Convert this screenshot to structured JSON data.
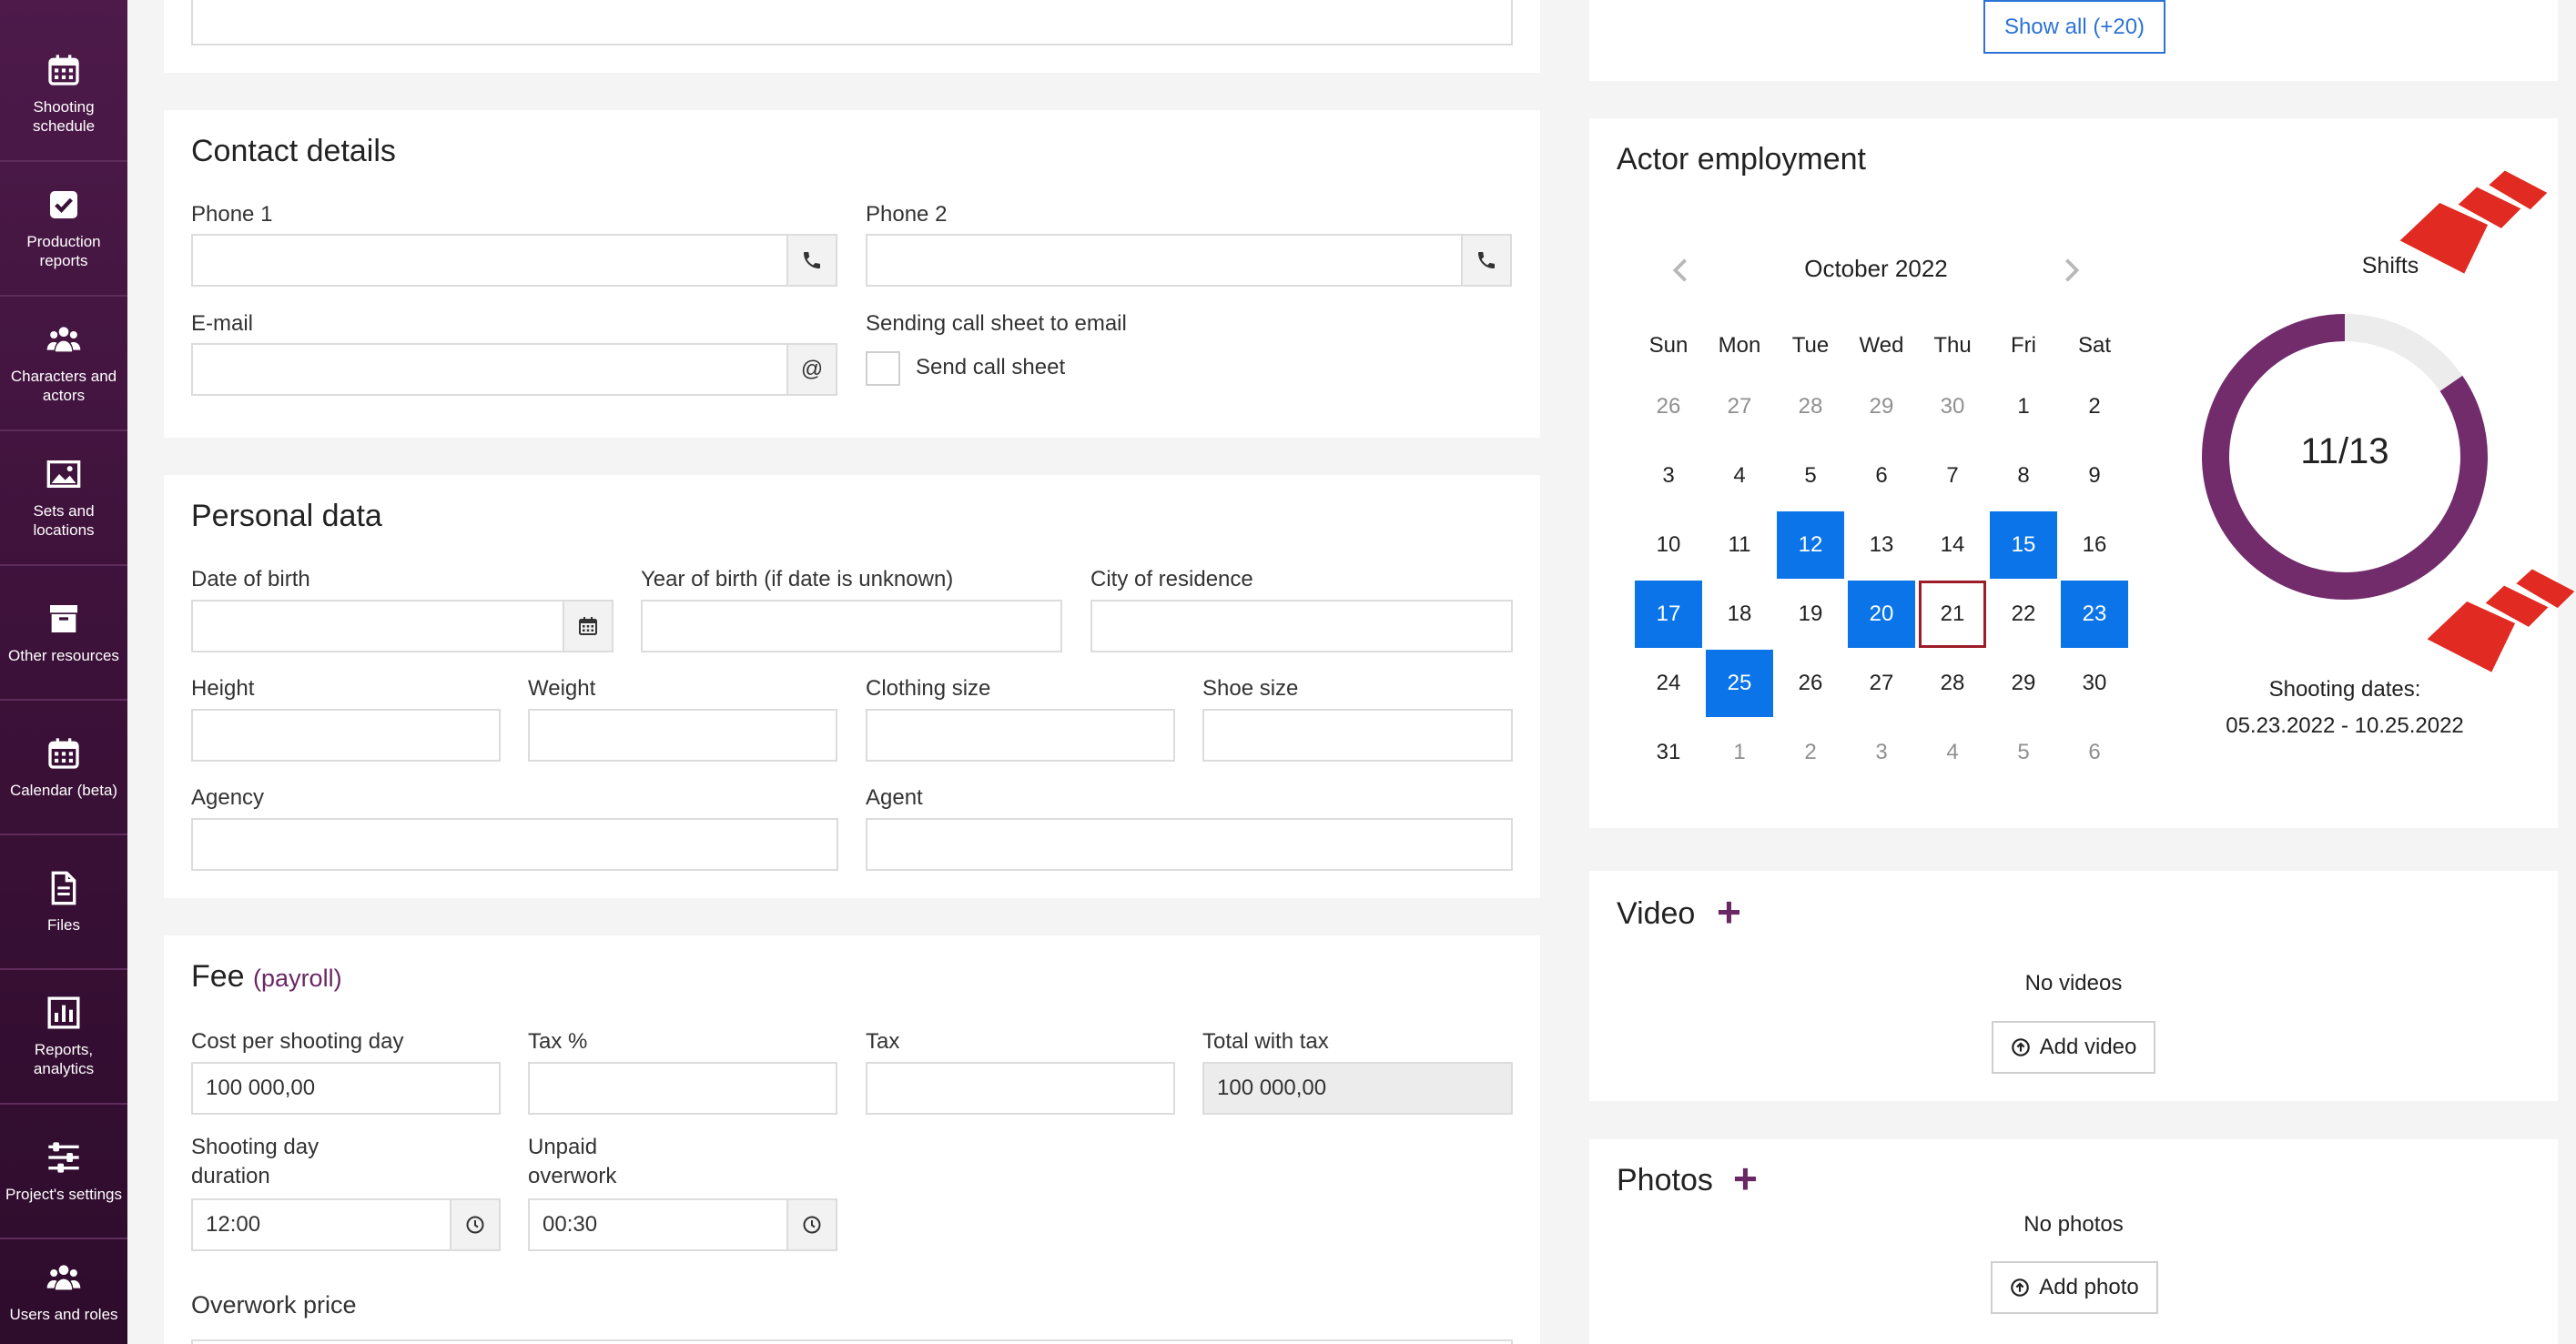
{
  "sidebar": {
    "items": [
      {
        "label": "Shooting schedule",
        "icon": "calendar-grid-icon"
      },
      {
        "label": "Production reports",
        "icon": "checkbox-icon"
      },
      {
        "label": "Characters and actors",
        "icon": "people-icon"
      },
      {
        "label": "Sets and locations",
        "icon": "picture-icon"
      },
      {
        "label": "Other resources",
        "icon": "archive-box-icon"
      },
      {
        "label": "Calendar (beta)",
        "icon": "calendar-grid-icon"
      },
      {
        "label": "Files",
        "icon": "file-icon"
      },
      {
        "label": "Reports, analytics",
        "icon": "bar-chart-icon"
      },
      {
        "label": "Project's settings",
        "icon": "sliders-icon"
      },
      {
        "label": "Users and roles",
        "icon": "people-icon"
      }
    ]
  },
  "contact": {
    "title": "Contact details",
    "phone1_label": "Phone 1",
    "phone2_label": "Phone 2",
    "email_label": "E-mail",
    "email_addon": "@",
    "sending_label": "Sending call sheet to email",
    "send_checkbox_label": "Send call sheet"
  },
  "personal": {
    "title": "Personal data",
    "dob_label": "Date of birth",
    "yob_label": "Year of birth (if date is unknown)",
    "city_label": "City of residence",
    "height_label": "Height",
    "weight_label": "Weight",
    "clothing_label": "Clothing size",
    "shoe_label": "Shoe size",
    "agency_label": "Agency",
    "agent_label": "Agent"
  },
  "fee": {
    "title": "Fee",
    "payroll": "(payroll)",
    "cost_label": "Cost per shooting day",
    "cost_value": "100 000,00",
    "taxpct_label": "Tax %",
    "tax_label": "Tax",
    "total_label": "Total with tax",
    "total_value": "100 000,00",
    "duration_label_1": "Shooting day",
    "duration_label_2": "duration",
    "duration_value": "12:00",
    "overwork_label_1": "Unpaid",
    "overwork_label_2": "overwork",
    "overwork_value": "00:30",
    "overwork_price_label": "Overwork price"
  },
  "top_card": {
    "show_all": "Show all (+20)"
  },
  "employment": {
    "title": "Actor employment",
    "month": "October 2022",
    "weekdays": [
      "Sun",
      "Mon",
      "Tue",
      "Wed",
      "Thu",
      "Fri",
      "Sat"
    ],
    "weeks": [
      [
        "26",
        "27",
        "28",
        "29",
        "30",
        "1",
        "2"
      ],
      [
        "3",
        "4",
        "5",
        "6",
        "7",
        "8",
        "9"
      ],
      [
        "10",
        "11",
        "12",
        "13",
        "14",
        "15",
        "16"
      ],
      [
        "17",
        "18",
        "19",
        "20",
        "21",
        "22",
        "23"
      ],
      [
        "24",
        "25",
        "26",
        "27",
        "28",
        "29",
        "30"
      ],
      [
        "31",
        "1",
        "2",
        "3",
        "4",
        "5",
        "6"
      ]
    ],
    "shifts_label": "Shifts",
    "shifts_value": "11/13",
    "shifts_done": 11,
    "shifts_total": 13,
    "dates_label": "Shooting dates:",
    "dates_value": "05.23.2022 - 10.25.2022",
    "colors": {
      "selected": "#0a74e8",
      "today_border": "#9c1c28",
      "ring": "#722c6c",
      "ring_track": "#ececec",
      "annotation": "#e02a22"
    }
  },
  "video": {
    "title": "Video",
    "add_icon": "+",
    "empty": "No videos",
    "button": "Add video"
  },
  "photos": {
    "title": "Photos",
    "add_icon": "+",
    "empty": "No photos",
    "button": "Add photo"
  }
}
